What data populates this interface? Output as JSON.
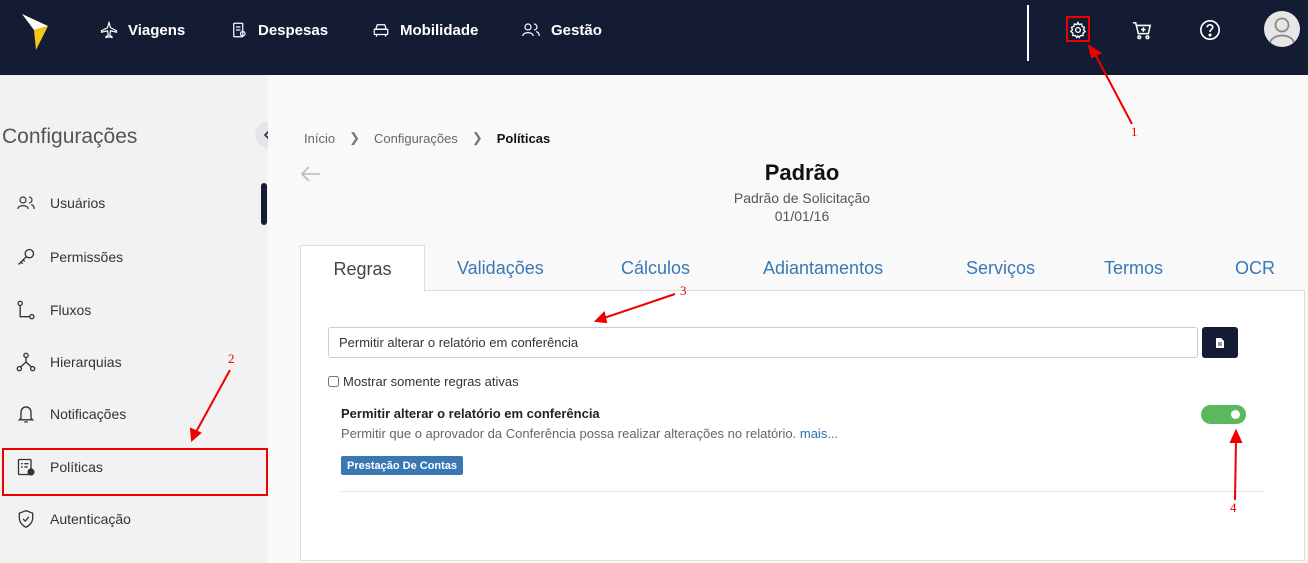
{
  "topnav": {
    "items": [
      {
        "label": "Viagens",
        "icon": "airplane-icon"
      },
      {
        "label": "Despesas",
        "icon": "receipt-icon"
      },
      {
        "label": "Mobilidade",
        "icon": "car-icon"
      },
      {
        "label": "Gestão",
        "icon": "users-icon"
      }
    ],
    "right_icons": [
      "gear-icon",
      "cart-icon",
      "help-icon",
      "avatar"
    ]
  },
  "sidebar": {
    "title": "Configurações",
    "items": [
      {
        "label": "Usuários",
        "icon": "users-icon"
      },
      {
        "label": "Permissões",
        "icon": "key-icon"
      },
      {
        "label": "Fluxos",
        "icon": "flow-icon"
      },
      {
        "label": "Hierarquias",
        "icon": "hierarchy-icon"
      },
      {
        "label": "Notificações",
        "icon": "bell-icon"
      },
      {
        "label": "Políticas",
        "icon": "policy-icon"
      },
      {
        "label": "Autenticação",
        "icon": "shield-icon"
      }
    ]
  },
  "breadcrumb": {
    "items": [
      "Início",
      "Configurações",
      "Políticas"
    ]
  },
  "page": {
    "title": "Padrão",
    "subtitle": "Padrão de Solicitação",
    "date": "01/01/16"
  },
  "tabs": [
    "Regras",
    "Validações",
    "Cálculos",
    "Adiantamentos",
    "Serviços",
    "Termos",
    "OCR"
  ],
  "active_tab": "Regras",
  "search": {
    "value": "Permitir alterar o relatório em conferência"
  },
  "filter": {
    "label": "Mostrar somente regras ativas",
    "checked": false
  },
  "rule": {
    "title": "Permitir alterar o relatório em conferência",
    "description": "Permitir que o aprovador da Conferência possa realizar alterações no relatório.",
    "more_link": "mais...",
    "badge": "Prestação De Contas",
    "enabled": true
  },
  "annotations": [
    "1",
    "2",
    "3",
    "4"
  ],
  "colors": {
    "topbar": "#141c33",
    "accent": "#3a78b5",
    "toggle_on": "#5cb85c",
    "annotation": "#e00000",
    "logo": "#f5c518"
  }
}
